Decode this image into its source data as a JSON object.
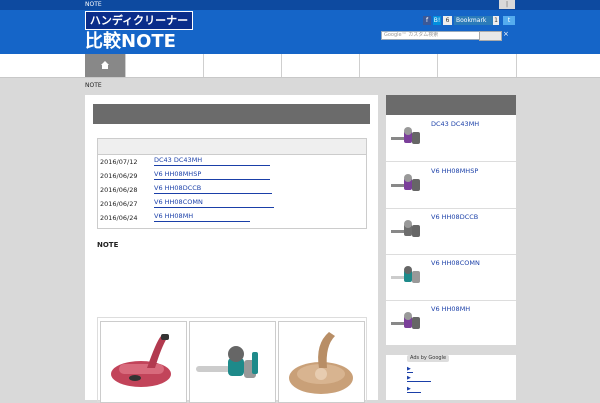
{
  "header": {
    "top_note": "NOTE",
    "top_tab": "|",
    "logo_line1": "ハンディクリーナー",
    "logo_line2": "比較NOTE",
    "social": {
      "fb": "f",
      "hatena": "B!",
      "share_count": "6",
      "bookmark": "Bookmark",
      "bookmark_count": "1",
      "tw": "t"
    },
    "search_placeholder": "Google™ カスタム検索",
    "search_clear": "×"
  },
  "nav": {
    "home_icon": "house-icon",
    "items_count_visible": 5
  },
  "breadcrumb": "NOTE",
  "posts": [
    {
      "date": "2016/07/12",
      "title": "DC43  DC43MH"
    },
    {
      "date": "2016/06/29",
      "title": "V6  HH08MHSP"
    },
    {
      "date": "2016/06/28",
      "title": "V6  HH08DCCB"
    },
    {
      "date": "2016/06/27",
      "title": "V6  HH08COMN"
    },
    {
      "date": "2016/06/24",
      "title": "V6  HH08MH"
    }
  ],
  "note_label": "NOTE",
  "sidebar": {
    "items": [
      {
        "title": "DC43  DC43MH"
      },
      {
        "title": "V6  HH08MHSP"
      },
      {
        "title": "V6  HH08DCCB"
      },
      {
        "title": "V6  HH08COMN"
      },
      {
        "title": "V6  HH08MH"
      }
    ]
  },
  "ads": {
    "label": "Ads by Google",
    "links": [
      "▶",
      "▶",
      "▶"
    ]
  },
  "colors": {
    "header": "#1565c8",
    "link": "#1a3fa8",
    "panel_head": "#6b6b6b"
  }
}
